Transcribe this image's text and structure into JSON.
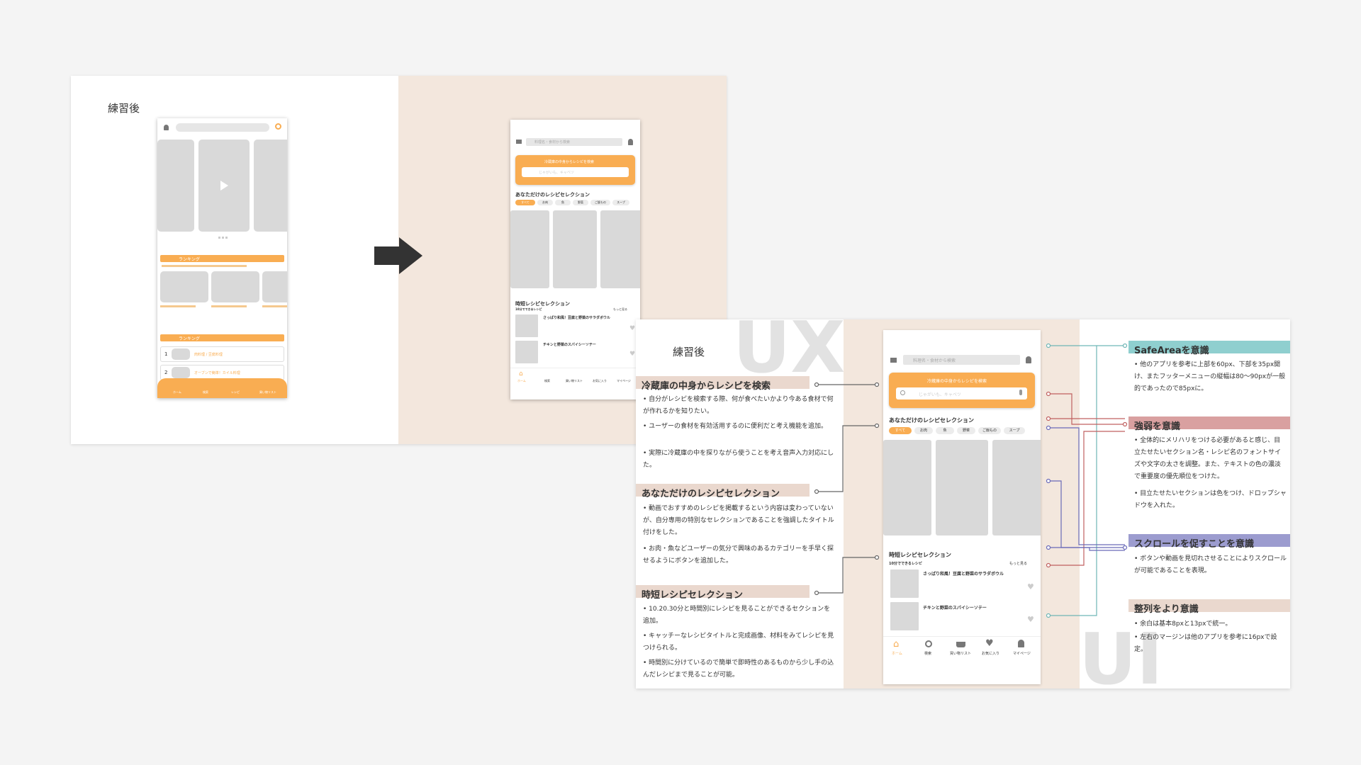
{
  "slide1": {
    "title": "練習後",
    "before_phone": {
      "section1_label": "ランキング",
      "section2_label": "ランキング",
      "rank_items": [
        "1",
        "2"
      ],
      "rank_item_texts": [
        "肉料理 / 豆腐料理",
        "オーブンで簡単！カイル料理"
      ],
      "footer_items": [
        "ホーム",
        "検索",
        "レシピ",
        "買い物リスト"
      ]
    },
    "after_phone": {
      "search_placeholder": "料理名・食材から検索",
      "fridge_title": "冷蔵庫の中身からレシピを検索",
      "fridge_placeholder": "じゃがいも、キャベツ",
      "selection_title": "あなただけのレシピセレクション",
      "categories": [
        "すべて",
        "お肉",
        "魚",
        "野菜",
        "ご飯もの",
        "スープ"
      ],
      "short_title": "時短レシピセレクション",
      "short_subtitle": "10分でできるレシピ",
      "more_link": "もっと見る",
      "recipes": [
        {
          "name": "さっぱり和風！豆腐と野菜のサラダボウル"
        },
        {
          "name": "チキンと野菜のスパイシーソテー"
        }
      ],
      "footer_items": [
        "ホーム",
        "検索",
        "買い物リスト",
        "お気に入り",
        "マイページ"
      ]
    }
  },
  "slide2": {
    "title": "練習後",
    "bg_ux": "UX",
    "bg_ui": "UI",
    "left_sections": [
      {
        "title": "冷蔵庫の中身からレシピを検索",
        "bullets": [
          "自分がレシピを検索する際、何が食べたいかより今ある食材で何が作れるかを知りたい。",
          "ユーザーの食材を有効活用するのに便利だと考え機能を追加。",
          "実際に冷蔵庫の中を探りながら使うことを考え音声入力対応にした。"
        ]
      },
      {
        "title": "あなただけのレシピセレクション",
        "bullets": [
          "動画でおすすめのレシピを掲載するという内容は変わっていないが、自分専用の特別なセレクションであることを強調したタイトル付けをした。",
          "お肉・魚などユーザーの気分で興味のあるカテゴリーを手早く探せるようにボタンを追加した。"
        ]
      },
      {
        "title": "時短レシピセレクション",
        "bullets": [
          "10.20.30分と時間別にレシピを見ることができるセクションを追加。",
          "キャッチーなレシピタイトルと完成画像、材料をみてレシピを見つけられる。",
          "時間別に分けているので簡単で即時性のあるものから少し手の込んだレシピまで見ることが可能。"
        ]
      }
    ],
    "right_sections": [
      {
        "title": "SafeAreaを意識",
        "color": "#8fcfcf",
        "bullets": [
          "他のアプリを参考に上部を60px、下部を35px開け、またフッターメニューの縦幅は80〜90pxが一般的であったので85pxに。"
        ]
      },
      {
        "title": "強弱を意識",
        "color": "#d9a0a0",
        "bullets": [
          "全体的にメリハリをつける必要があると感じ、目立たせたいセクション名・レシピ名のフォントサイズや文字の太さを調整。また、テキストの色の濃淡で重要度の優先順位をつけた。",
          "目立たせたいセクションは色をつけ、ドロップシャドウを入れた。"
        ]
      },
      {
        "title": "スクロールを促すことを意識",
        "color": "#9c9ccf",
        "bullets": [
          "ボタンや動画を見切れさせることによりスクロールが可能であることを表現。"
        ]
      },
      {
        "title": "整列をより意識",
        "color": "#ead8ce",
        "bullets": [
          "余白は基本8pxと13pxで統一。",
          "左右のマージンは他のアプリを参考に16pxで設定。"
        ]
      }
    ]
  },
  "colors": {
    "accent": "#f9ad52",
    "beige": "#f3e7dd",
    "heading_bg": "#ead8ce"
  },
  "icons": [
    "arrow-right-icon",
    "search-icon",
    "user-icon",
    "mic-icon",
    "home-icon",
    "basket-icon",
    "heart-icon",
    "play-icon",
    "chevron-right-icon",
    "crown-icon",
    "menu-icon"
  ]
}
